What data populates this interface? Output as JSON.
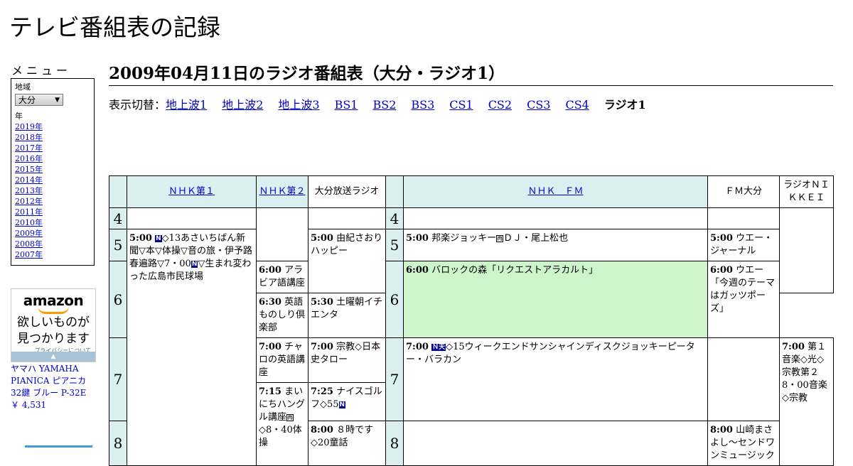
{
  "site": {
    "title": "テレビ番組表の記録"
  },
  "menu": {
    "title": "メニュー",
    "region_label": "地域",
    "region_value": "大分",
    "year_label": "年",
    "years": [
      "2019年",
      "2018年",
      "2017年",
      "2016年",
      "2015年",
      "2014年",
      "2013年",
      "2012年",
      "2011年",
      "2010年",
      "2009年",
      "2008年",
      "2007年"
    ]
  },
  "ad": {
    "logo": "amazon",
    "tagline_1": "欲しいものが",
    "tagline_2": "見つかります",
    "privacy": "プライバシーについて",
    "product_name": "ヤマハ YAMAHA PIANICA ピアニカ 32鍵 ブルー P-32E",
    "price": "￥ 4,531"
  },
  "page": {
    "heading": "2009年04月11日のラジオ番組表（大分・ラジオ1）"
  },
  "switcher": {
    "label": "表示切替：",
    "links": [
      "地上波1",
      "地上波2",
      "地上波3",
      "BS1",
      "BS2",
      "BS3",
      "CS1",
      "CS2",
      "CS3",
      "CS4"
    ],
    "current": "ラジオ1"
  },
  "schedule": {
    "channels": [
      "ＮＨＫ第１",
      "ＮＨＫ第２",
      "大分放送ラジオ",
      "ＮＨＫ　ＦＭ",
      "ＦＭ大分",
      "ラジオＮＩＫＫＥＩ"
    ],
    "hours": [
      "4",
      "5",
      "6",
      "7",
      "8"
    ],
    "programs": {
      "nhk1_500": {
        "time": "5:00",
        "a": "◇13あさいちばん新聞▽本▽体操▽音の旅・伊予路春遍路▽7・00",
        "b": "▽生まれ変わった広島市民球場"
      },
      "nhk2_600": {
        "time": "6:00",
        "title": "アラビア語講座"
      },
      "nhk2_630": {
        "time": "6:30",
        "title": "英語ものしり倶楽部"
      },
      "nhk2_700": {
        "time": "7:00",
        "title": "チャロの英語講座"
      },
      "nhk2_715": {
        "time": "7:15",
        "a": "まいにちハングル講座",
        "b": "◇8・40体操"
      },
      "obs_500": {
        "time": "5:00",
        "title": "由紀さおりハッピー"
      },
      "obs_530": {
        "time": "5:30",
        "title": "土曜朝イチエンタ"
      },
      "obs_700": {
        "time": "7:00",
        "title": "宗教◇日本史タロー"
      },
      "obs_725": {
        "time": "7:25",
        "title": "ナイスゴルフ◇55"
      },
      "obs_800": {
        "time": "8:00",
        "title": "８時です◇20童話"
      },
      "fm_500": {
        "time": "5:00",
        "title": "邦楽ジョッキー",
        "b": "ＤＪ・尾上松也"
      },
      "fm_600": {
        "time": "6:00",
        "title": "バロックの森「リクエストアラカルト」"
      },
      "fm_700": {
        "time": "7:00",
        "title": "◇15ウィークエンドサンシャインディスクジョッキーピーター・バラカン"
      },
      "fmoita_500": {
        "time": "5:00",
        "title": "ウエー・ジャーナル"
      },
      "fmoita_600": {
        "time": "6:00",
        "title": "ウエー「今週のテーマはガッツポーズ」"
      },
      "fmoita_800": {
        "time": "8:00",
        "title": "山崎まさよし～センドワンミュージック"
      },
      "nikkei_700": {
        "time": "7:00",
        "title": "第１音楽◇光◇宗教第２8・00音楽◇宗教"
      }
    },
    "icons": {
      "news": "N",
      "stereo": "Ｎ天",
      "rebroadcast": "再"
    }
  },
  "colors": {
    "header_bg": "#daf0f0",
    "highlight_bg": "#ccf5cc",
    "link": "#0000cc",
    "icon_bg": "#00009a"
  }
}
